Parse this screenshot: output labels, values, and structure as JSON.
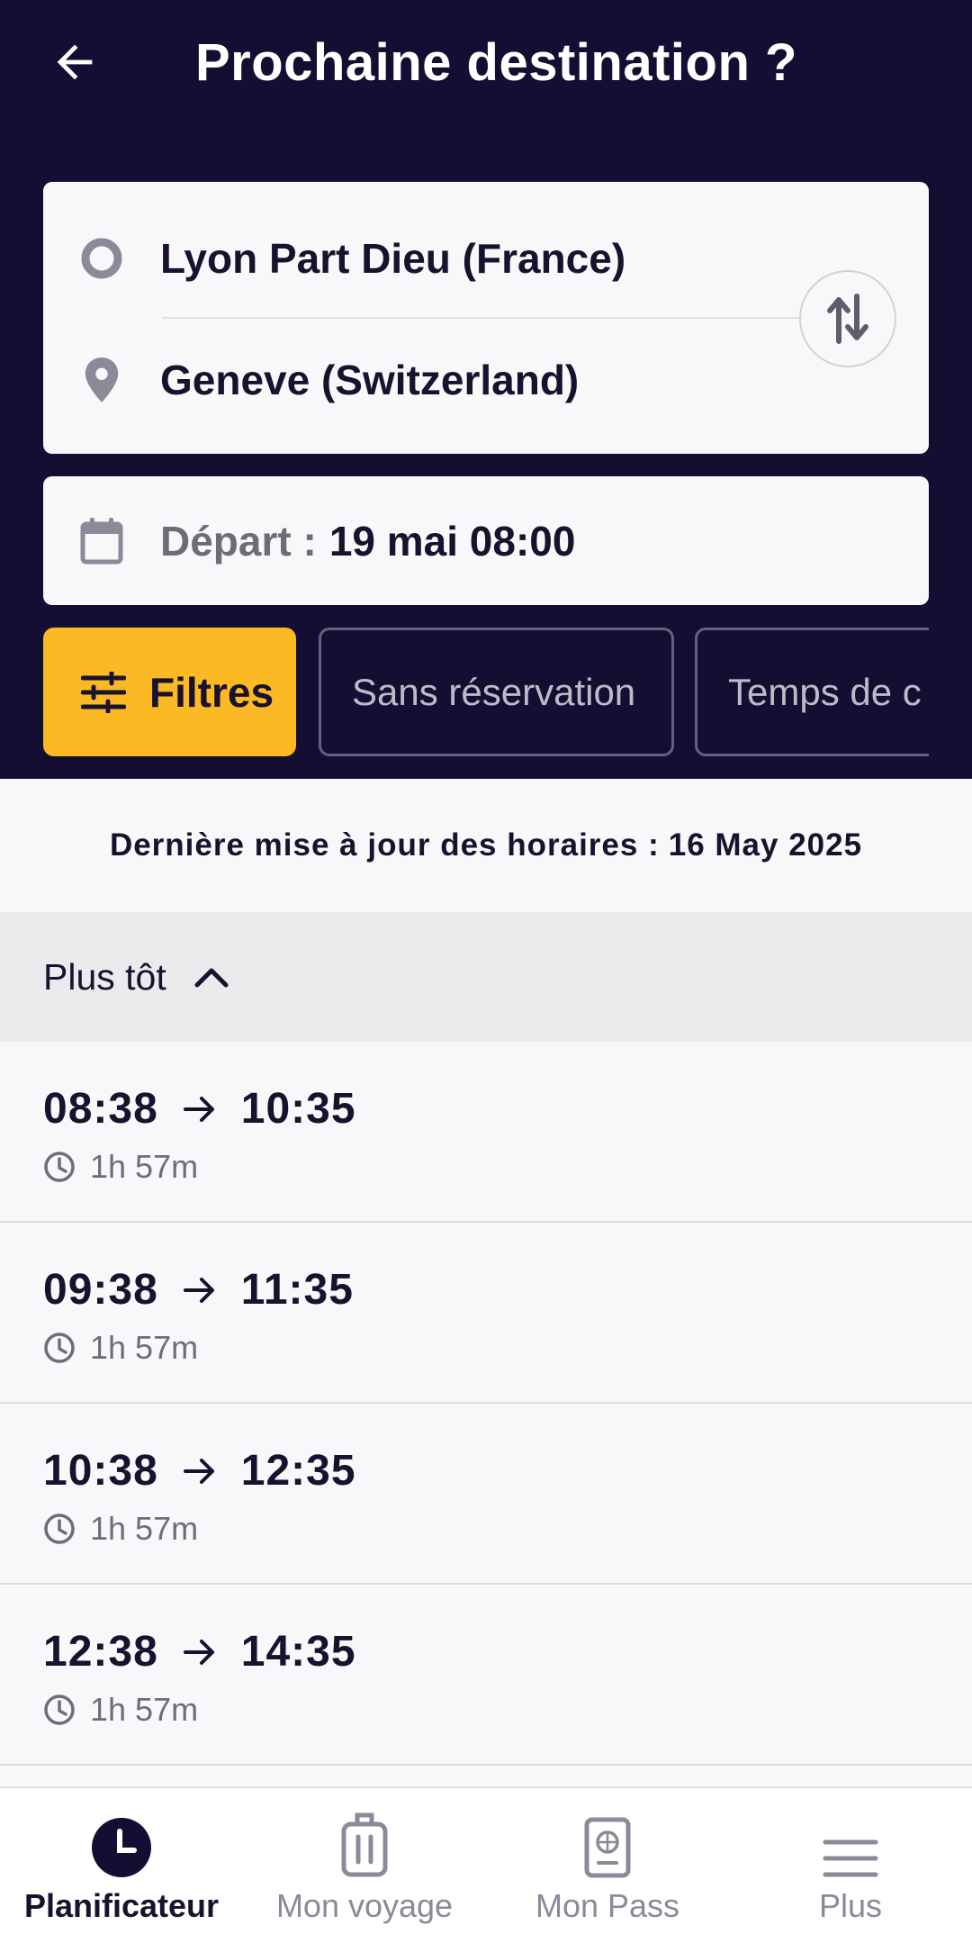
{
  "header": {
    "title": "Prochaine destination ?",
    "origin": "Lyon Part Dieu (France)",
    "destination": "Geneve (Switzerland)",
    "departure_label": "Départ :",
    "departure_value": "19 mai 08:00"
  },
  "filters": {
    "main_label": "Filtres",
    "chips": [
      "Sans réservation",
      "Temps de c"
    ]
  },
  "update": {
    "label": "Dernière mise à jour des horaires :",
    "date": "16 May 2025"
  },
  "earlier": {
    "label": "Plus tôt"
  },
  "journeys": [
    {
      "dep": "08:38",
      "arr": "10:35",
      "duration": "1h 57m"
    },
    {
      "dep": "09:38",
      "arr": "11:35",
      "duration": "1h 57m"
    },
    {
      "dep": "10:38",
      "arr": "12:35",
      "duration": "1h 57m"
    },
    {
      "dep": "12:38",
      "arr": "14:35",
      "duration": "1h 57m"
    }
  ],
  "nav": {
    "items": [
      {
        "label": "Planificateur",
        "icon": "clock-icon",
        "active": true
      },
      {
        "label": "Mon voyage",
        "icon": "luggage-icon",
        "active": false
      },
      {
        "label": "Mon Pass",
        "icon": "passport-icon",
        "active": false
      },
      {
        "label": "Plus",
        "icon": "menu-icon",
        "active": false
      }
    ]
  },
  "colors": {
    "header_bg": "#150e33",
    "accent": "#fbb924",
    "text_dark": "#18122e"
  }
}
